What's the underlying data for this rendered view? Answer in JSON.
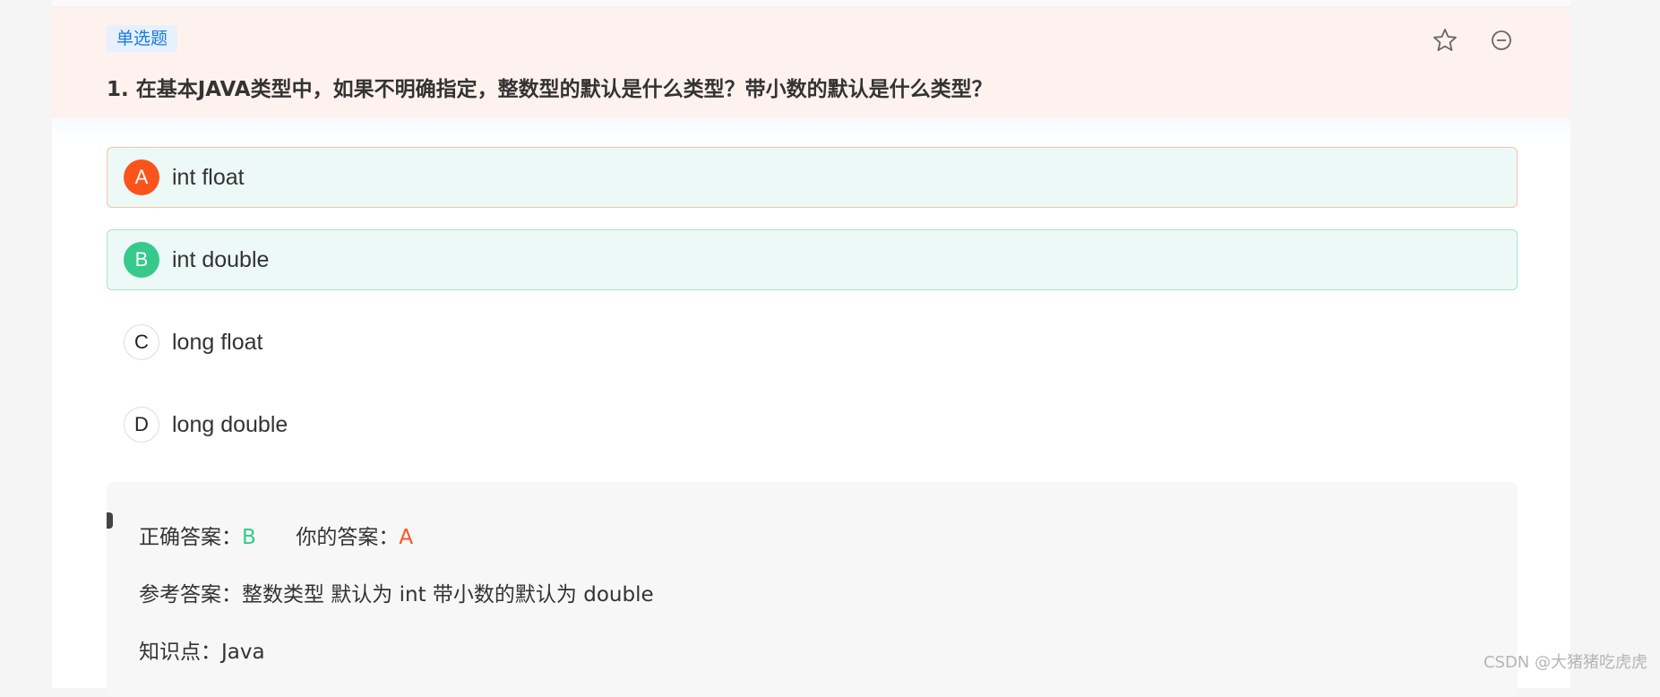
{
  "question": {
    "type_tag": "单选题",
    "text": "1. 在基本JAVA类型中，如果不明确指定，整数型的默认是什么类型？带小数的默认是什么类型？",
    "actions": {
      "favorite_icon": "star-icon",
      "remove_icon": "minus-circle-icon"
    }
  },
  "options": [
    {
      "letter": "A",
      "text": "int float",
      "state": "wrong"
    },
    {
      "letter": "B",
      "text": "int double",
      "state": "correct"
    },
    {
      "letter": "C",
      "text": "long float",
      "state": "none"
    },
    {
      "letter": "D",
      "text": "long double",
      "state": "none"
    }
  ],
  "answer": {
    "correct_label": "正确答案：",
    "correct_value": "B",
    "yours_label": "你的答案：",
    "yours_value": "A",
    "reference_label": "参考答案：",
    "reference_text": "整数类型 默认为 int 带小数的默认为 double",
    "knowledge_label": "知识点：",
    "knowledge_value": "Java"
  },
  "watermark": "CSDN @大猪猪吃虎虎",
  "colors": {
    "wrong": "#fa541c",
    "correct": "#36c98b",
    "tag": "#1a7ae0",
    "header_bg": "#fef2ef"
  }
}
